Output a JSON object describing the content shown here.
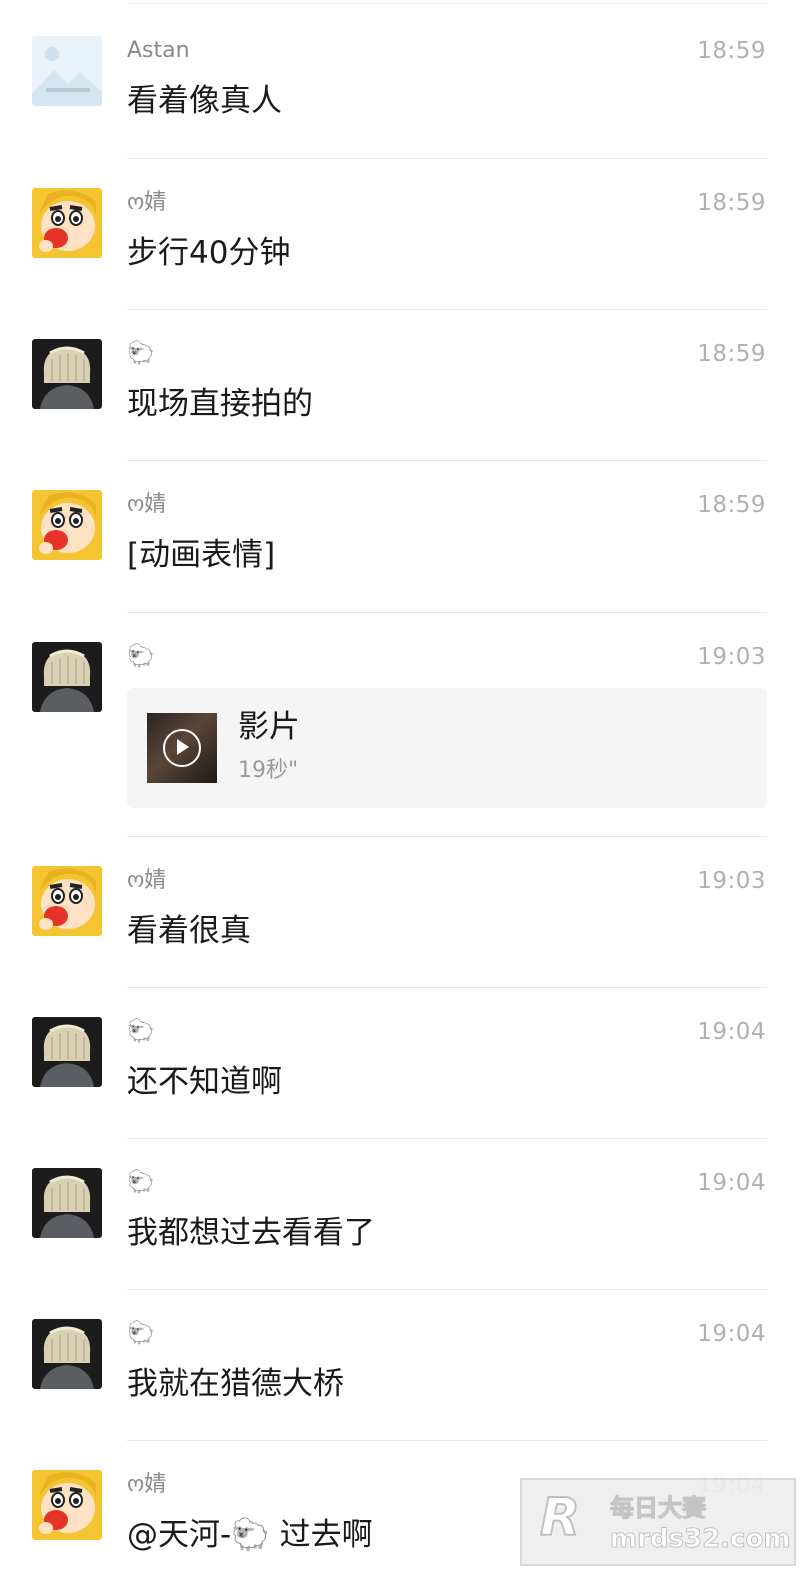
{
  "messages": [
    {
      "sender": "Astan",
      "time": "18:59",
      "text": "看着像真人",
      "avatar": "landscape-placeholder-avatar"
    },
    {
      "sender": "ო婧",
      "time": "18:59",
      "text": "步行40分钟",
      "avatar": "cartoon-boy-avatar"
    },
    {
      "sender": "🐑",
      "time": "18:59",
      "text": "现场直接拍的",
      "avatar": "blonde-hair-avatar"
    },
    {
      "sender": "ო婧",
      "time": "18:59",
      "text": "[动画表情]",
      "avatar": "cartoon-boy-avatar"
    },
    {
      "sender": "🐑",
      "time": "19:03",
      "avatar": "blonde-hair-avatar",
      "video": {
        "title": "影片",
        "duration": "19秒\""
      }
    },
    {
      "sender": "ო婧",
      "time": "19:03",
      "text": "看着很真",
      "avatar": "cartoon-boy-avatar"
    },
    {
      "sender": "🐑",
      "time": "19:04",
      "text": "还不知道啊",
      "avatar": "blonde-hair-avatar"
    },
    {
      "sender": "🐑",
      "time": "19:04",
      "text": "我都想过去看看了",
      "avatar": "blonde-hair-avatar"
    },
    {
      "sender": "🐑",
      "time": "19:04",
      "text": "我就在猎德大桥",
      "avatar": "blonde-hair-avatar"
    },
    {
      "sender": "ო婧",
      "time": "19:04",
      "text": "@天河-🐑 过去啊",
      "avatar": "cartoon-boy-avatar"
    }
  ],
  "watermark": {
    "logo": "R",
    "title": "每日大賽",
    "url": "mrds32.com"
  },
  "colors": {
    "divider": "#e8e8e8",
    "meta": "#8a8a8a",
    "time": "#b0b0b0",
    "card": "#f5f5f5"
  }
}
